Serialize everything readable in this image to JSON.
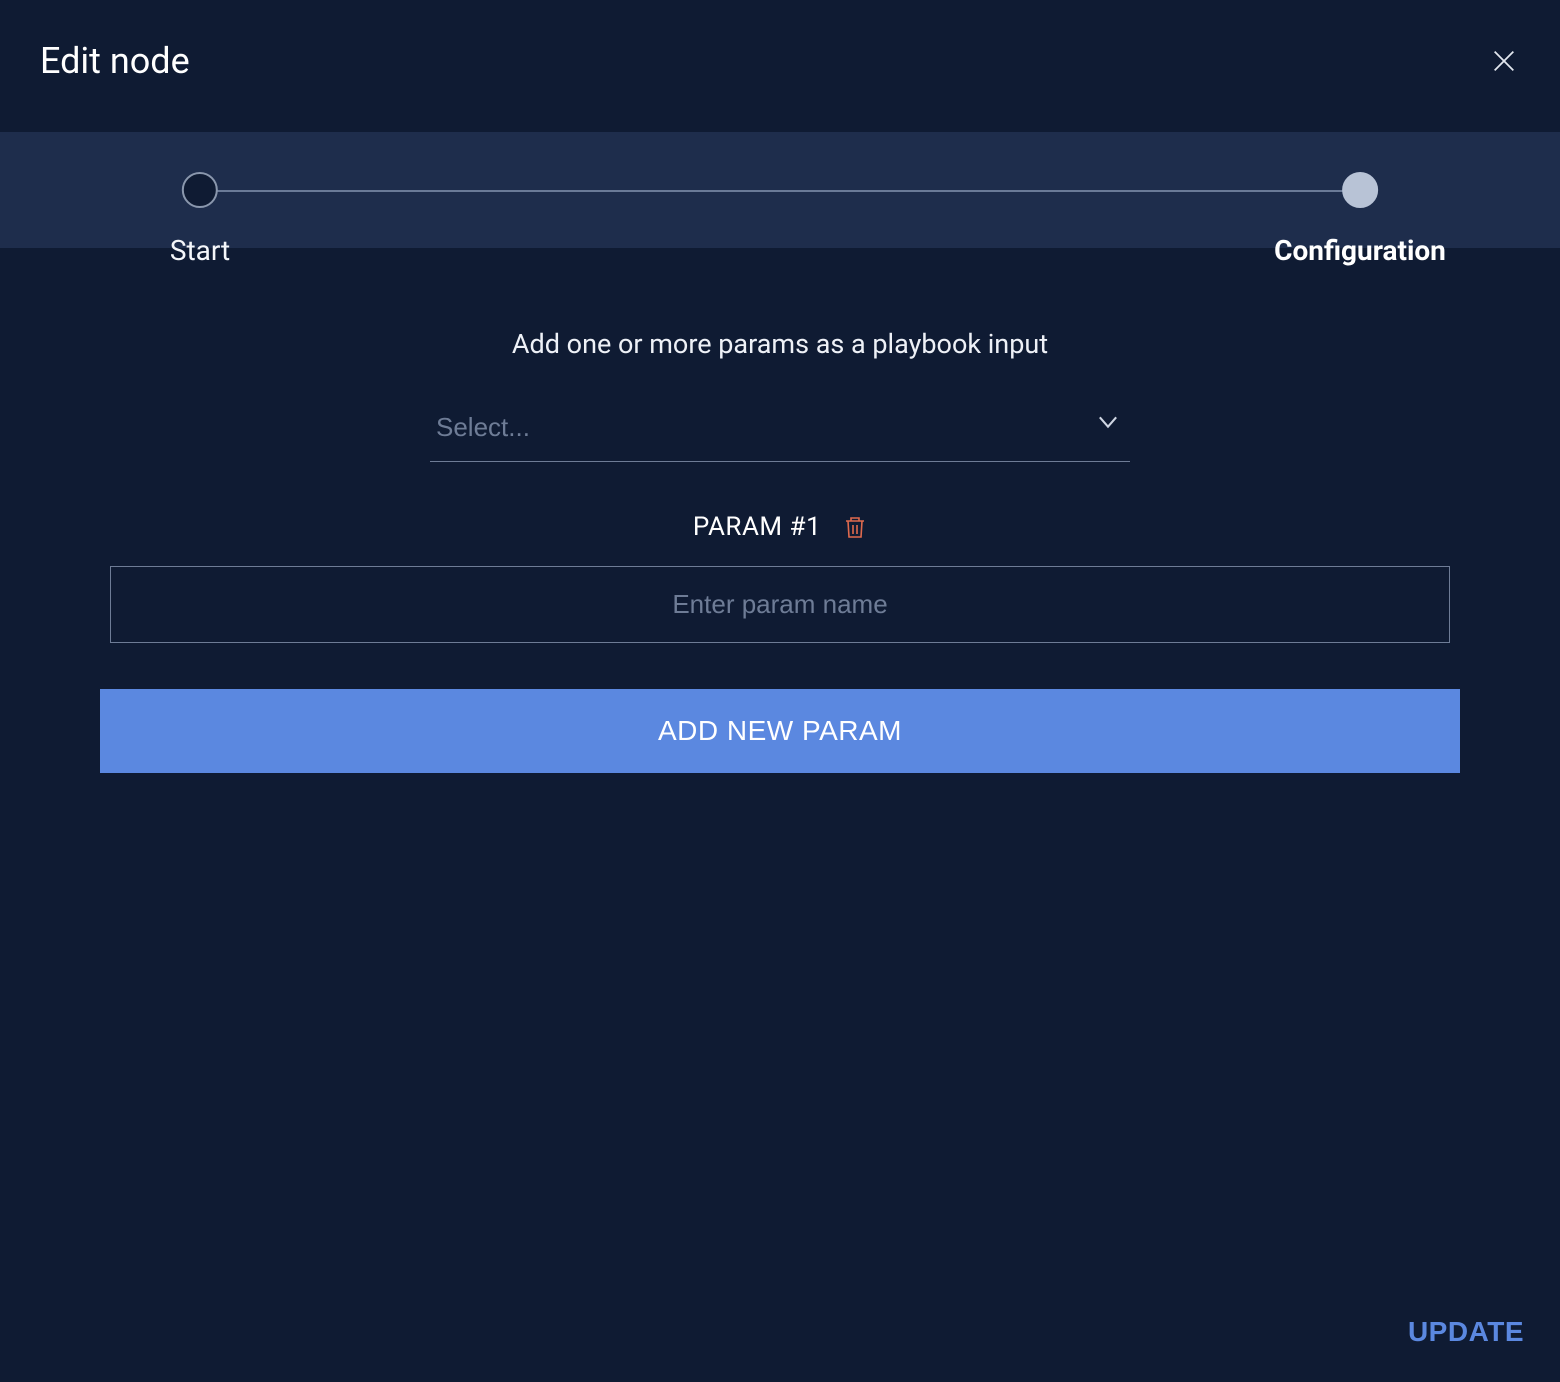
{
  "header": {
    "title": "Edit node"
  },
  "stepper": {
    "steps": [
      {
        "label": "Start",
        "active": false
      },
      {
        "label": "Configuration",
        "active": true
      }
    ]
  },
  "content": {
    "instruction": "Add one or more params as a playbook input",
    "select_placeholder": "Select...",
    "param_label": "PARAM  #1",
    "param_name_placeholder": "Enter param name",
    "add_button_label": "ADD NEW PARAM"
  },
  "footer": {
    "update_label": "UPDATE"
  },
  "icons": {
    "close": "close-icon",
    "chevron_down": "chevron-down-icon",
    "trash": "trash-icon"
  }
}
